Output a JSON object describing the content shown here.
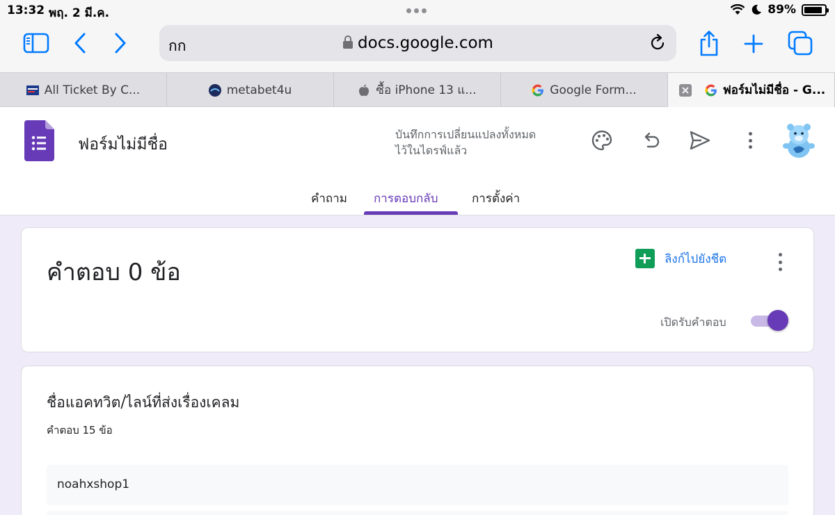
{
  "status_bar": {
    "time": "13:32",
    "date": "พฤ. 2 มี.ค.",
    "battery": "89%",
    "battery_level": 0.89
  },
  "browser": {
    "address_aa": "กก",
    "url": "docs.google.com",
    "icons": [
      "sidebar-icon",
      "back-icon",
      "forward-icon",
      "lock-icon",
      "reload-icon",
      "share-icon",
      "new-tab-icon",
      "tabs-overview-icon"
    ],
    "tabs": [
      {
        "label": "All Ticket By C...",
        "favicon": "ticket-favicon"
      },
      {
        "label": "metabet4u",
        "favicon": "metabet-favicon"
      },
      {
        "label": "ซื้อ iPhone 13 แ...",
        "favicon": "apple-favicon"
      },
      {
        "label": "Google Form...",
        "favicon": "google-favicon"
      },
      {
        "label": "ฟอร์มไม่มีชื่อ - G...",
        "favicon": "google-favicon",
        "active": true
      }
    ]
  },
  "forms": {
    "title": "ฟอร์มไม่มีชื่อ",
    "save_status_line1": "บันทึกการเปลี่ยนแปลงทั้งหมด",
    "save_status_line2": "ไว้ในไดรฟ์แล้ว",
    "tabs": [
      "คำถาม",
      "การตอบกลับ",
      "การตั้งค่า"
    ],
    "active_tab": 1,
    "accent": "#673ab7"
  },
  "summary": {
    "response_count": "คำตอบ 0 ข้อ",
    "sheet_link": "ลิงก์ไปยังชีต",
    "accepting_label": "เปิดรับคำตอบ",
    "accepting": true
  },
  "question": {
    "title": "ชื่อแอคทวิต/ไลน์ที่ส่งเรื่องเคลม",
    "count": "คำตอบ 15 ข้อ",
    "answers": [
      "noahxshop1"
    ]
  }
}
